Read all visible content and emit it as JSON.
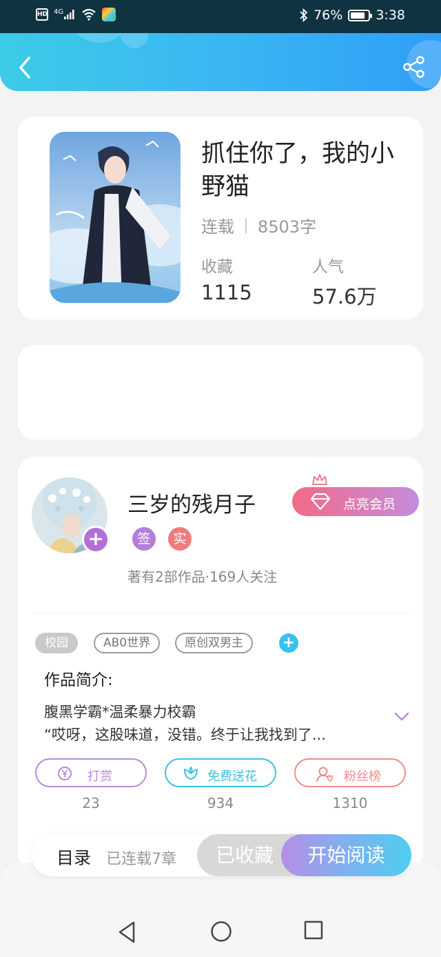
{
  "status_bar": {
    "hd": "HD",
    "network": "4G",
    "battery": "76%",
    "time": "3:38"
  },
  "book": {
    "title": "抓住你了，我的小野猫",
    "status": "连载",
    "word_count": "8503字",
    "favorites_label": "收藏",
    "favorites_value": "1115",
    "popularity_label": "人气",
    "popularity_value": "57.6万"
  },
  "author": {
    "name": "三岁的残月子",
    "badges": [
      "签",
      "实"
    ],
    "info": "著有2部作品·169人关注",
    "vip_label": "点亮会员"
  },
  "tags": [
    "校园",
    "AB0世界",
    "原创双男主"
  ],
  "intro": {
    "title": "作品简介:",
    "line1": "腹黑学霸*温柔暴力校霸",
    "line2": "“哎呀，这股味道，没错。终于让我找到了..."
  },
  "actions": [
    {
      "label": "打赏",
      "count": "23",
      "color": "#b88ad8"
    },
    {
      "label": "免费送花",
      "count": "934",
      "color": "#3cc2e0"
    },
    {
      "label": "粉丝榜",
      "count": "1310",
      "color": "#ef8b8b"
    }
  ],
  "bottom_bar": {
    "catalog": "目录",
    "progress": "已连载7章",
    "collected": "已收藏",
    "read": "开始阅读"
  }
}
